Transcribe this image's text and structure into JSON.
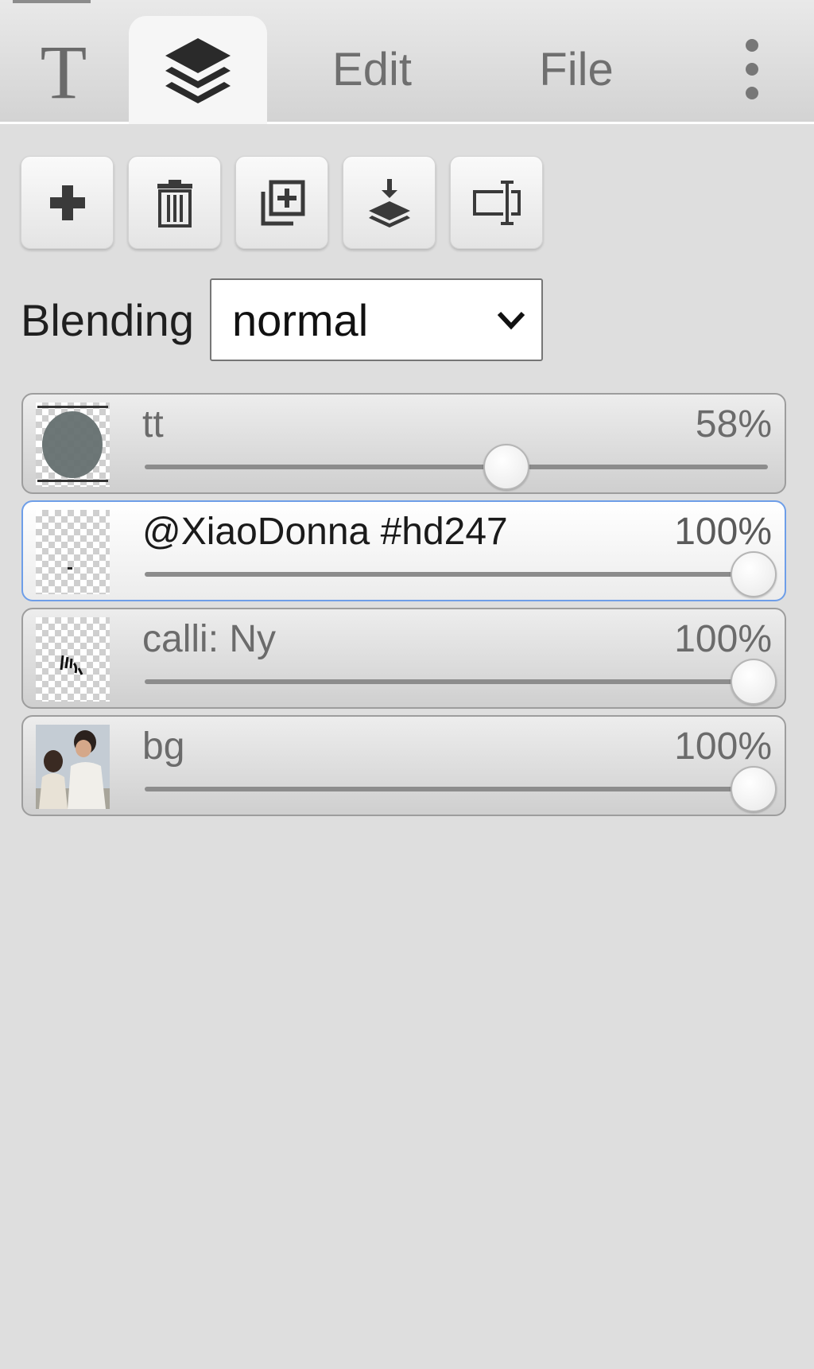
{
  "tabs": [
    {
      "label": "T",
      "icon": "text-icon"
    },
    {
      "label": "",
      "icon": "layers-icon",
      "active": true
    },
    {
      "label": "Edit"
    },
    {
      "label": "File"
    },
    {
      "label": "",
      "icon": "kebab-menu-icon"
    }
  ],
  "toolbar": {
    "buttons": [
      {
        "icon": "add-icon"
      },
      {
        "icon": "trash-icon"
      },
      {
        "icon": "duplicate-icon"
      },
      {
        "icon": "merge-down-icon"
      },
      {
        "icon": "text-cursor-icon"
      }
    ]
  },
  "blending": {
    "label": "Blending",
    "value": "normal"
  },
  "layers": [
    {
      "name": "tt",
      "opacity_text": "58%",
      "opacity": 0.58,
      "selected": false,
      "thumb": "ellipse"
    },
    {
      "name": "@XiaoDonna #hd247",
      "opacity_text": "100%",
      "opacity": 1.0,
      "selected": true,
      "thumb": "transparent-dot"
    },
    {
      "name": "calli: Ny",
      "opacity_text": "100%",
      "opacity": 1.0,
      "selected": false,
      "thumb": "calligraphy"
    },
    {
      "name": "bg",
      "opacity_text": "100%",
      "opacity": 1.0,
      "selected": false,
      "thumb": "photo"
    }
  ],
  "colors": {
    "panel_bg": "#dedede",
    "selected_border": "#6e9ee8",
    "text_muted": "#6b6b6b"
  }
}
